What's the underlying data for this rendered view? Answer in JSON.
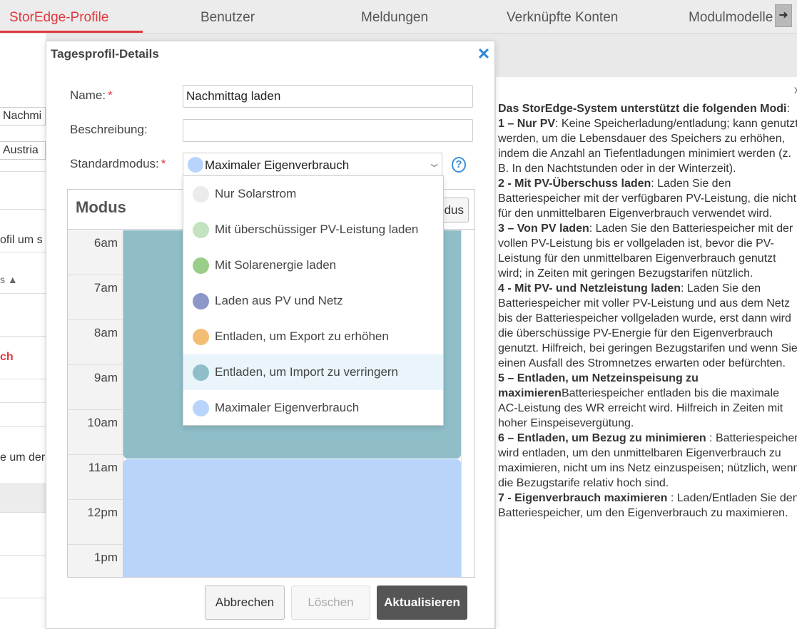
{
  "tabs": [
    {
      "label": "StorEdge-Profile",
      "active": true
    },
    {
      "label": "Benutzer"
    },
    {
      "label": "Meldungen"
    },
    {
      "label": "Verknüpfte Konten"
    },
    {
      "label": "Modulmodelle"
    }
  ],
  "background": {
    "profile_name": "Nachmi",
    "country": "Austria",
    "text1": "ofil um s",
    "sort_label": "s ▲",
    "highlight": "ch",
    "text2": "e um der"
  },
  "dialog": {
    "title": "Tagesprofil-Details",
    "close_glyph": "✕",
    "name_label": "Name:",
    "name_value": "Nachmittag laden",
    "description_label": "Beschreibung:",
    "description_value": "",
    "mode_label": "Standardmodus:",
    "required_mark": "*",
    "mode_selected": "Maximaler Eigenverbrauch",
    "mode_selected_color": "#b9d4fb",
    "help_glyph": "?",
    "schedule": {
      "header": "Modus",
      "modus_button": "dus",
      "times": [
        "6am",
        "7am",
        "8am",
        "9am",
        "10am",
        "11am",
        "12pm",
        "1pm"
      ],
      "colors": {
        "block1": "#8fbec9",
        "block2": "#b9d4fb"
      }
    },
    "dropdown_options": [
      {
        "label": "Nur Solarstrom",
        "color": "#ebebeb"
      },
      {
        "label": "Mit überschüssiger PV-Leistung laden",
        "color": "#c3e3c0"
      },
      {
        "label": "Mit Solarenergie laden",
        "color": "#9acd88"
      },
      {
        "label": "Laden aus PV und Netz",
        "color": "#8c97c9"
      },
      {
        "label": "Entladen, um Export zu erhöhen",
        "color": "#f3bd73"
      },
      {
        "label": "Entladen, um Import zu verringern",
        "color": "#8fbec9",
        "highlighted": true
      },
      {
        "label": "Maximaler Eigenverbrauch",
        "color": "#b9d4fb"
      }
    ],
    "buttons": {
      "cancel": "Abbrechen",
      "delete": "Löschen",
      "update": "Aktualisieren"
    }
  },
  "help_panel": {
    "close_glyph": "x",
    "intro_bold": "Das StorEdge-System unterstützt die folgenden Modi",
    "intro_rest": ":",
    "items": [
      {
        "title": "1 – Nur PV",
        "text": ": Keine Speicherladung/entladung; kann genutzt werden, um die Lebensdauer des Speichers zu erhöhen, indem die Anzahl an Tiefentladungen minimiert werden (z. B. In den Nachtstunden oder in der Winterzeit)."
      },
      {
        "title": "2 - Mit PV-Überschuss laden",
        "text": ": Laden Sie den Batteriespeicher mit der verfügbaren PV-Leistung, die nicht für den unmittelbaren Eigenverbrauch verwendet wird."
      },
      {
        "title": "3 – Von PV laden",
        "text": ": Laden Sie den Batteriespeicher mit der vollen PV-Leistung bis er vollgeladen ist, bevor die PV-Leistung für den unmittelbaren Eigenverbrauch genutzt wird; in Zeiten mit geringen Bezugstarifen nützlich."
      },
      {
        "title": "4 - Mit PV- und Netzleistung laden",
        "text": ": Laden Sie den Batteriespeicher mit voller PV-Leistung und aus dem Netz bis der Batteriespeicher vollgeladen wurde, erst dann wird die überschüssige PV-Energie für den Eigenverbrauch genutzt. Hilfreich, bei geringen Bezugstarifen und wenn Sie einen Ausfall des Stromnetzes erwarten oder befürchten."
      },
      {
        "title": "5 – Entladen, um Netzeinspeisung zu maximieren",
        "text": "Batteriespeicher entladen bis die maximale AC-Leistung des WR erreicht wird. Hilfreich in Zeiten mit hoher Einspeisevergütung."
      },
      {
        "title": "6 – Entladen, um Bezug zu minimieren",
        "text": " : Batteriespeicher wird entladen, um den unmittelbaren Eigenverbrauch zu maximieren, nicht um ins Netz einzuspeisen; nützlich, wenn die Bezugstarife relativ hoch sind."
      },
      {
        "title": "7 - Eigenverbrauch maximieren",
        "text": " : Laden/Entladen Sie den Batteriespeicher, um den Eigenverbrauch zu maximieren."
      }
    ]
  }
}
